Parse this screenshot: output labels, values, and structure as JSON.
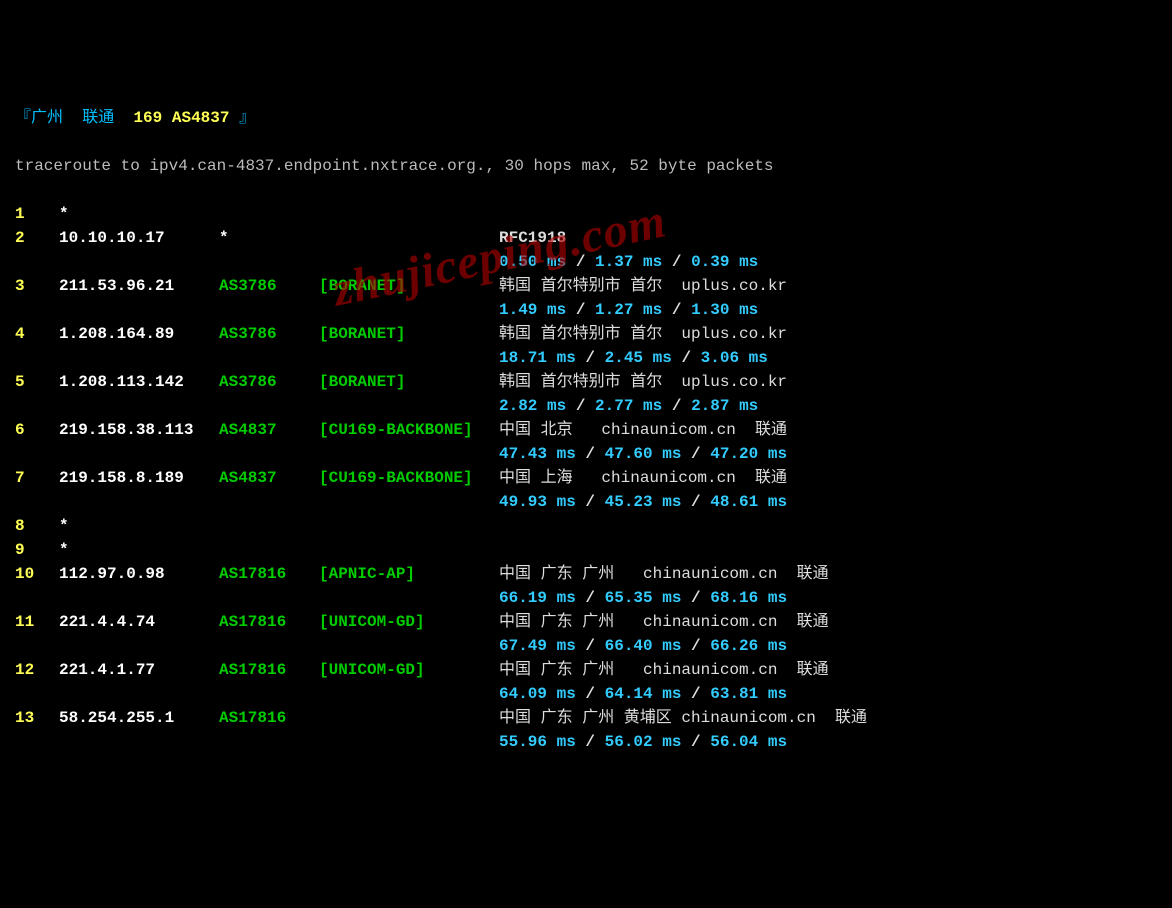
{
  "header": {
    "prefix": "『",
    "city": "广州",
    "carrier": "联通",
    "asn_label": "169 AS4837",
    "suffix": " 』"
  },
  "command": "traceroute to ipv4.can-4837.endpoint.nxtrace.org., 30 hops max, 52 byte packets",
  "watermark": "zhujiceping.com",
  "hops": [
    {
      "n": "1",
      "ip": "*",
      "asn": "",
      "asname": "",
      "geo": "",
      "latency": []
    },
    {
      "n": "2",
      "ip": "10.10.10.17",
      "asn": "*",
      "asname": "",
      "geo": "RFC1918",
      "latency": [
        "0.50 ms",
        "1.37 ms",
        "0.39 ms"
      ]
    },
    {
      "n": "3",
      "ip": "211.53.96.21",
      "asn": "AS3786",
      "asname": "[BORANET]",
      "geo": "韩国 首尔特别市 首尔  uplus.co.kr",
      "latency": [
        "1.49 ms",
        "1.27 ms",
        "1.30 ms"
      ]
    },
    {
      "n": "4",
      "ip": "1.208.164.89",
      "asn": "AS3786",
      "asname": "[BORANET]",
      "geo": "韩国 首尔特别市 首尔  uplus.co.kr",
      "latency": [
        "18.71 ms",
        "2.45 ms",
        "3.06 ms"
      ]
    },
    {
      "n": "5",
      "ip": "1.208.113.142",
      "asn": "AS3786",
      "asname": "[BORANET]",
      "geo": "韩国 首尔特别市 首尔  uplus.co.kr",
      "latency": [
        "2.82 ms",
        "2.77 ms",
        "2.87 ms"
      ]
    },
    {
      "n": "6",
      "ip": "219.158.38.113",
      "asn": "AS4837",
      "asname": "[CU169-BACKBONE]",
      "geo": "中国 北京   chinaunicom.cn  联通",
      "latency": [
        "47.43 ms",
        "47.60 ms",
        "47.20 ms"
      ]
    },
    {
      "n": "7",
      "ip": "219.158.8.189",
      "asn": "AS4837",
      "asname": "[CU169-BACKBONE]",
      "geo": "中国 上海   chinaunicom.cn  联通",
      "latency": [
        "49.93 ms",
        "45.23 ms",
        "48.61 ms"
      ]
    },
    {
      "n": "8",
      "ip": "*",
      "asn": "",
      "asname": "",
      "geo": "",
      "latency": []
    },
    {
      "n": "9",
      "ip": "*",
      "asn": "",
      "asname": "",
      "geo": "",
      "latency": []
    },
    {
      "n": "10",
      "ip": "112.97.0.98",
      "asn": "AS17816",
      "asname": "[APNIC-AP]",
      "geo": "中国 广东 广州   chinaunicom.cn  联通",
      "latency": [
        "66.19 ms",
        "65.35 ms",
        "68.16 ms"
      ]
    },
    {
      "n": "11",
      "ip": "221.4.4.74",
      "asn": "AS17816",
      "asname": "[UNICOM-GD]",
      "geo": "中国 广东 广州   chinaunicom.cn  联通",
      "latency": [
        "67.49 ms",
        "66.40 ms",
        "66.26 ms"
      ]
    },
    {
      "n": "12",
      "ip": "221.4.1.77",
      "asn": "AS17816",
      "asname": "[UNICOM-GD]",
      "geo": "中国 广东 广州   chinaunicom.cn  联通",
      "latency": [
        "64.09 ms",
        "64.14 ms",
        "63.81 ms"
      ]
    },
    {
      "n": "13",
      "ip": "58.254.255.1",
      "asn": "AS17816",
      "asname": "",
      "geo": "中国 广东 广州 黄埔区 chinaunicom.cn  联通",
      "latency": [
        "55.96 ms",
        "56.02 ms",
        "56.04 ms"
      ]
    }
  ]
}
